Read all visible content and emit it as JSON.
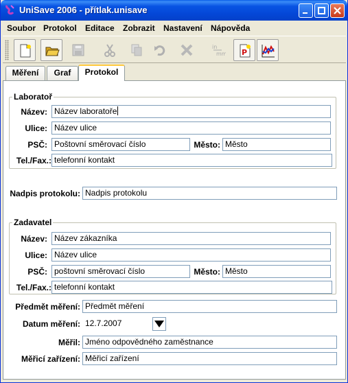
{
  "window": {
    "title": "UniSave 2006 - přítlak.unisave",
    "minimize": "_",
    "maximize": "□",
    "close": "X"
  },
  "menu": [
    "Soubor",
    "Protokol",
    "Editace",
    "Zobrazit",
    "Nastavení",
    "Nápověda"
  ],
  "toolbar": {
    "tools": [
      {
        "icon": "new-document-icon",
        "enabled": true
      },
      {
        "icon": "open-folder-icon",
        "enabled": true
      },
      {
        "icon": "save-disk-icon",
        "enabled": false
      },
      {
        "icon": "cut-icon",
        "enabled": false
      },
      {
        "icon": "copy-icon",
        "enabled": false
      },
      {
        "icon": "undo-icon",
        "enabled": false
      },
      {
        "icon": "delete-icon",
        "enabled": false
      },
      {
        "icon": "units-icon",
        "enabled": false
      },
      {
        "icon": "protocol-icon",
        "enabled": true
      },
      {
        "icon": "graph-icon",
        "enabled": true
      }
    ]
  },
  "tabs": [
    {
      "label": "Měření",
      "active": false
    },
    {
      "label": "Graf",
      "active": false
    },
    {
      "label": "Protokol",
      "active": true
    }
  ],
  "laboratory": {
    "title": "Laboratoř",
    "name_label": "Název:",
    "name_value": "Název laboratoře",
    "street_label": "Ulice:",
    "street_value": "Název ulice",
    "zip_label": "PSČ:",
    "zip_value": "Poštovní směrovací číslo",
    "city_label": "Město:",
    "city_value": "Město",
    "phone_label": "Tel./Fax.:",
    "phone_value": "telefonní kontakt"
  },
  "protocol_heading": {
    "label": "Nadpis protokolu:",
    "value": "Nadpis protokolu"
  },
  "client": {
    "title": "Zadavatel",
    "name_label": "Název:",
    "name_value": "Název zákazníka",
    "street_label": "Ulice:",
    "street_value": "Název ulice",
    "zip_label": "PSČ:",
    "zip_value": "poštovní směrovací číslo",
    "city_label": "Město:",
    "city_value": "Město",
    "phone_label": "Tel./Fax.:",
    "phone_value": "telefonní kontakt"
  },
  "measurement": {
    "subject_label": "Předmět měření:",
    "subject_value": "Předmět měření",
    "date_label": "Datum měření:",
    "date_value": "12.7.2007",
    "measured_by_label": "Měřil:",
    "measured_by_value": "Jméno odpovědného zaměstnance",
    "device_label": "Měřicí zařízení:",
    "device_value": "Měřicí zařízení"
  },
  "colors": {
    "titlebar": "#0854e3",
    "field_border": "#7f9db9",
    "active_tab_accent": "#ffc83c"
  }
}
